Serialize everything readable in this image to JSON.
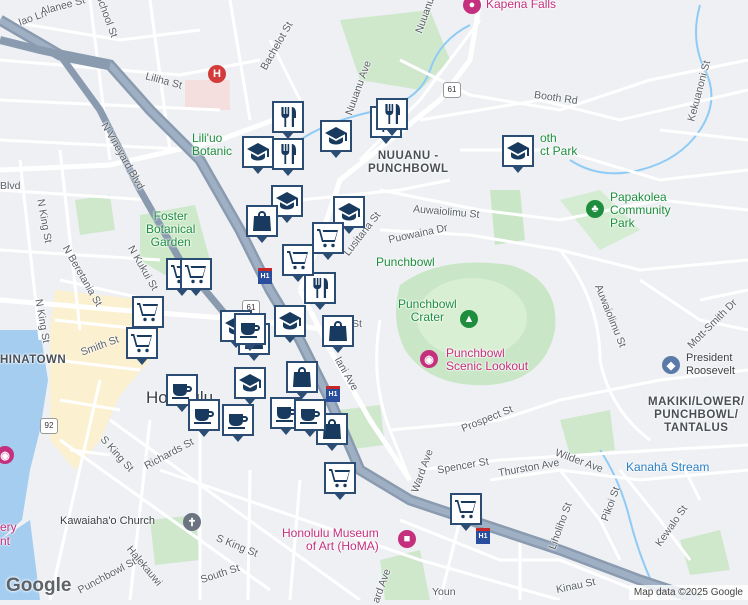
{
  "districts": {
    "nuuanu_punchbowl": "NUUANU -\nPUNCHBOWL",
    "makiki": "MAKIKI/LOWER/\nPUNCHBOWL/\nTANTALUS",
    "chinatown": "HINATOWN",
    "honolulu": "Honolulu"
  },
  "streets": {
    "iao": "Iao Ln",
    "alanee": "Alanee St",
    "school": "School St",
    "nuuanu": "Nuuanu Ave",
    "liliha": "Liliha St",
    "bachelot": "Bachelot St",
    "booth": "Booth Rd",
    "kekuanoni": "Kekuanoni St",
    "n_vineyard": "N Vineyard Blvd",
    "blvd": "Blvd",
    "n_king": "N King St",
    "n_beretania": "N Beretania St",
    "n_kukui": "N Kukui St",
    "lusitana": "Lusitana St",
    "auwaiolimu": "Auwaiolimu St",
    "auwaiolimu2": "Auwaiolimu St",
    "puowaina": "Puowaina Dr",
    "smith": "Smith St",
    "s_king": "S King St",
    "richards": "Richards St",
    "s_king2": "S King St",
    "punchbowl_st": "Punchbowl St",
    "halekauwila": "Halekauwi",
    "south": "South St",
    "ward": "Ward Ave",
    "prospect": "Prospect St",
    "spencer": "Spencer St",
    "thurston": "Thurston Ave",
    "wilder": "Wilder Ave",
    "pikoi": "Pikoi St",
    "lunalilo_st": "Liholiho St",
    "kewalo": "Kewalo St",
    "mott_smith": "Mott-Smith Dr",
    "kinau": "Kinau St",
    "st_fragment": "St",
    "lani_ave": "lani Ave",
    "ard_ave": "ard Ave",
    "youn": "Youn"
  },
  "places": {
    "kapena_falls": "Kapena Falls",
    "foster": "Foster\nBotanical\nGarden",
    "liliuokalani": "Lili'uo\nBotanic",
    "booth_park": "oth\nct Park",
    "papakolea": "Papakolea\nCommunity\nPark",
    "punchbowl": "Punchbowl",
    "punchbowl_crater": "Punchbowl\nCrater",
    "punchbowl_lookout": "Punchbowl\nScenic Lookout",
    "president_roosevelt": "President\nRoosevelt",
    "kanaha": "Kanahā Stream",
    "kawaiahao": "Kawaiaha'o Church",
    "homa": "Honolulu Museum\nof Art (HoMA)",
    "ery": "ery",
    "nt": "nt"
  },
  "route_shields": {
    "r61a": "61",
    "r61b": "61",
    "r92": "92",
    "h1a": "H1",
    "h1b": "H1",
    "h1c": "H1"
  },
  "attribution": {
    "logo": "Google",
    "map_data": "Map data ©2025 Google"
  },
  "colors": {
    "marker_border": "#2b4d73",
    "marker_fill": "#ffffff",
    "icon": "#173a5e",
    "highway": "#8a9bb0",
    "water": "#9ecbef",
    "park": "#c8e6c9",
    "downtown": "#fdf3d4"
  },
  "markers": [
    {
      "type": "dining",
      "name": "dining-marker"
    },
    {
      "type": "dining",
      "name": "dining-marker"
    },
    {
      "type": "dining",
      "name": "dining-marker"
    },
    {
      "type": "dining",
      "name": "dining-marker"
    },
    {
      "type": "dining",
      "name": "dining-marker"
    },
    {
      "type": "school",
      "name": "school-marker"
    },
    {
      "type": "school",
      "name": "school-marker"
    },
    {
      "type": "school",
      "name": "school-marker"
    },
    {
      "type": "school",
      "name": "school-marker"
    },
    {
      "type": "school",
      "name": "school-marker"
    },
    {
      "type": "school",
      "name": "school-marker"
    },
    {
      "type": "school",
      "name": "school-marker"
    },
    {
      "type": "school",
      "name": "school-marker"
    },
    {
      "type": "shopping",
      "name": "shopping-marker"
    },
    {
      "type": "shopping",
      "name": "shopping-marker"
    },
    {
      "type": "shopping",
      "name": "shopping-marker"
    },
    {
      "type": "shopping",
      "name": "shopping-marker"
    },
    {
      "type": "shopping",
      "name": "shopping-marker"
    },
    {
      "type": "grocery",
      "name": "grocery-marker"
    },
    {
      "type": "grocery",
      "name": "grocery-marker"
    },
    {
      "type": "grocery",
      "name": "grocery-marker"
    },
    {
      "type": "grocery",
      "name": "grocery-marker"
    },
    {
      "type": "grocery",
      "name": "grocery-marker"
    },
    {
      "type": "grocery",
      "name": "grocery-marker"
    },
    {
      "type": "grocery",
      "name": "grocery-marker"
    },
    {
      "type": "grocery",
      "name": "grocery-marker"
    },
    {
      "type": "cafe",
      "name": "cafe-marker"
    },
    {
      "type": "cafe",
      "name": "cafe-marker"
    },
    {
      "type": "cafe",
      "name": "cafe-marker"
    },
    {
      "type": "cafe",
      "name": "cafe-marker"
    },
    {
      "type": "cafe",
      "name": "cafe-marker"
    },
    {
      "type": "cafe",
      "name": "cafe-marker"
    }
  ]
}
